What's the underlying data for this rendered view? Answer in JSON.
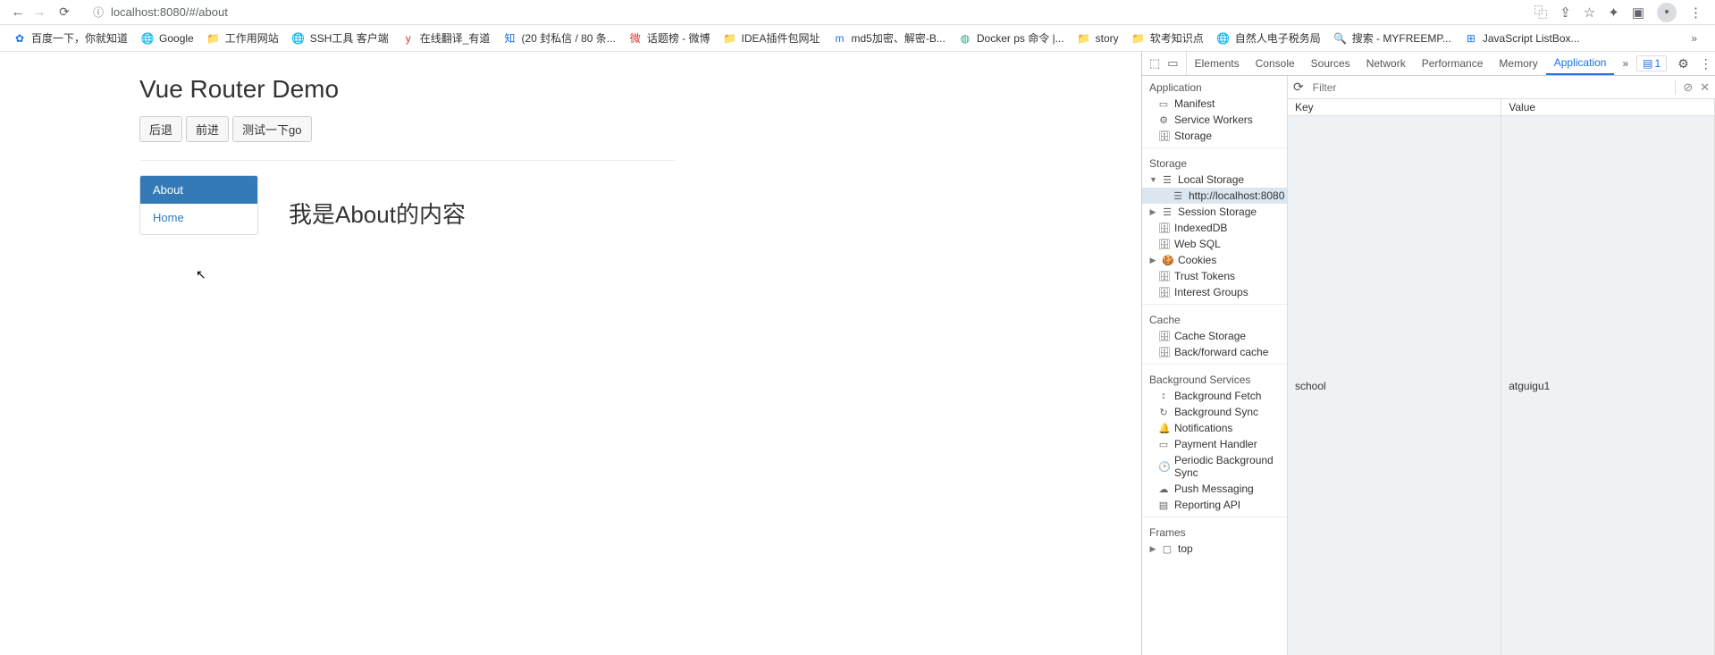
{
  "browser": {
    "url": "localhost:8080/#/about"
  },
  "bookmarks": [
    {
      "label": "百度一下，你就知道",
      "favClass": "blue"
    },
    {
      "label": "Google",
      "favClass": "globe"
    },
    {
      "label": "工作用网站",
      "favClass": "folder"
    },
    {
      "label": "SSH工具 客户端",
      "favClass": "globe"
    },
    {
      "label": "在线翻译_有道",
      "favClass": "red"
    },
    {
      "label": "(20 封私信 / 80 条...",
      "favClass": "blue"
    },
    {
      "label": "话题榜 - 微博",
      "favClass": "red"
    },
    {
      "label": "IDEA插件包网址",
      "favClass": "folder"
    },
    {
      "label": "md5加密、解密-B...",
      "favClass": "blue"
    },
    {
      "label": "Docker ps 命令 |...",
      "favClass": "green"
    },
    {
      "label": "story",
      "favClass": "folder"
    },
    {
      "label": "软考知识点",
      "favClass": "folder"
    },
    {
      "label": "自然人电子税务局",
      "favClass": "globe"
    },
    {
      "label": "搜索 - MYFREEMP...",
      "favClass": "globe"
    },
    {
      "label": "JavaScript ListBox...",
      "favClass": "blue"
    }
  ],
  "page": {
    "title": "Vue Router Demo",
    "btn_back": "后退",
    "btn_forward": "前进",
    "btn_test": "测试一下go",
    "nav_about": "About",
    "nav_home": "Home",
    "content": "我是About的内容"
  },
  "devtools": {
    "tabs": [
      "Elements",
      "Console",
      "Sources",
      "Network",
      "Performance",
      "Memory",
      "Application"
    ],
    "active_tab": "Application",
    "badge_count": "1",
    "side": {
      "application": {
        "label": "Application",
        "items": [
          "Manifest",
          "Service Workers",
          "Storage"
        ]
      },
      "storage": {
        "label": "Storage",
        "local_storage": "Local Storage",
        "local_origin": "http://localhost:8080",
        "session_storage": "Session Storage",
        "indexeddb": "IndexedDB",
        "websql": "Web SQL",
        "cookies": "Cookies",
        "trust_tokens": "Trust Tokens",
        "interest_groups": "Interest Groups"
      },
      "cache": {
        "label": "Cache",
        "cache_storage": "Cache Storage",
        "bf_cache": "Back/forward cache"
      },
      "bgservices": {
        "label": "Background Services",
        "items": [
          "Background Fetch",
          "Background Sync",
          "Notifications",
          "Payment Handler",
          "Periodic Background Sync",
          "Push Messaging",
          "Reporting API"
        ]
      },
      "frames": {
        "label": "Frames",
        "top": "top"
      }
    },
    "filter_placeholder": "Filter",
    "table": {
      "headers": [
        "Key",
        "Value"
      ],
      "rows": [
        {
          "key": "school",
          "value": "atguigu1"
        }
      ]
    }
  }
}
